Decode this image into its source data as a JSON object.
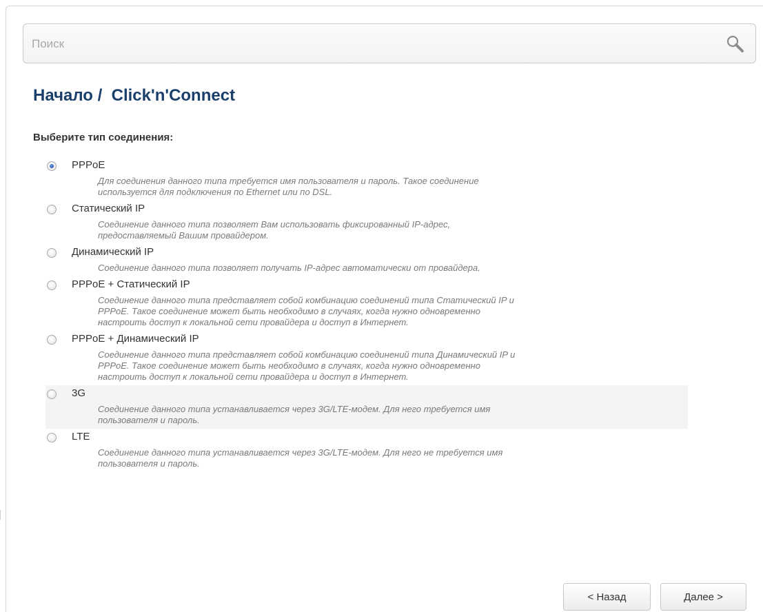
{
  "search": {
    "placeholder": "Поиск",
    "icon": "search-icon"
  },
  "breadcrumb": {
    "text": "Начало /  Click'n'Connect"
  },
  "section_title": "Выберите тип соединения:",
  "options": [
    {
      "label": "PPPoE",
      "checked": true,
      "desc": [
        "Для соединения данного типа требуется имя пользователя и пароль. Такое соединение",
        "используется для подключения по Ethernet или по DSL."
      ]
    },
    {
      "label": "Статический IP",
      "checked": false,
      "desc": [
        "Соединение данного типа позволяет Вам использовать фиксированный IP-адрес,",
        "предоставляемый Вашим провайдером."
      ]
    },
    {
      "label": "Динамический IP",
      "checked": false,
      "desc": [
        "Соединение данного типа позволяет получать IP-адрес автоматически от провайдера."
      ]
    },
    {
      "label": "PPPoE + Статический IP",
      "checked": false,
      "desc": [
        "Соединение данного типа представляет собой комбинацию соединений типа Статический IP и",
        "PPPoE. Такое соединение может быть необходимо в случаях, когда нужно одновременно",
        "настроить доступ к локальной сети провайдера и доступ в Интернет."
      ]
    },
    {
      "label": "PPPoE + Динамический IP",
      "checked": false,
      "desc": [
        "Соединение данного типа представляет собой комбинацию соединений типа Динамический IP и",
        "PPPoE. Такое соединение может быть необходимо в случаях, когда нужно одновременно",
        "настроить доступ к локальной сети провайдера и доступ в Интернет."
      ]
    },
    {
      "label": "3G",
      "checked": false,
      "highlighted": true,
      "desc": [
        "Соединение данного типа устанавливается через 3G/LTE-модем. Для него требуется имя",
        "пользователя и пароль."
      ]
    },
    {
      "label": "LTE",
      "checked": false,
      "desc": [
        "Соединение данного типа устанавливается через 3G/LTE-модем. Для него не требуется имя",
        "пользователя и пароль."
      ]
    }
  ],
  "buttons": {
    "back": "< Назад",
    "next": "Далее >"
  },
  "colors": {
    "title": "#1b3f6b",
    "desc": "#7a7a7a",
    "highlight_row": "#f4f4f4"
  }
}
